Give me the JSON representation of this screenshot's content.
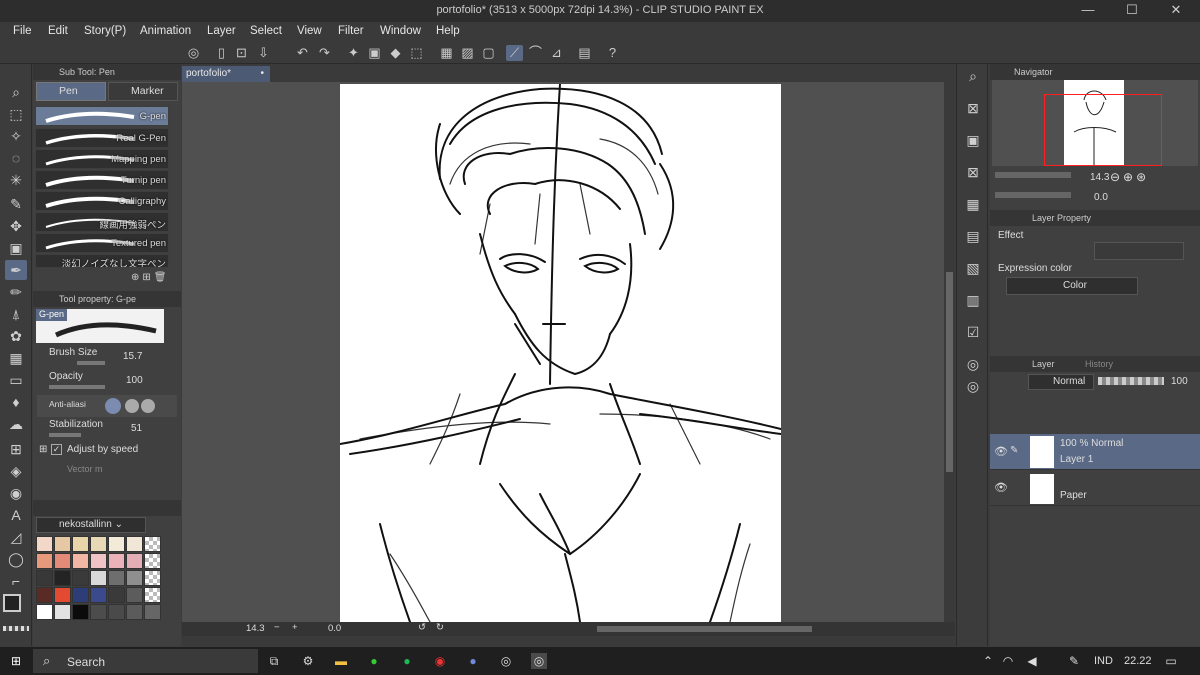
{
  "title": "portofolio* (3513 x 5000px 72dpi 14.3%) - CLIP STUDIO PAINT EX",
  "window_controls": [
    "—",
    "☐",
    "✕"
  ],
  "menu": [
    "File",
    "Edit",
    "Story(P)",
    "Animation",
    "Layer",
    "Select",
    "View",
    "Filter",
    "Window",
    "Help"
  ],
  "subtool": {
    "panel_title": "Sub Tool: Pen",
    "group_tabs": [
      "Pen",
      "Marker"
    ],
    "brushes": [
      "G-pen",
      "Real G-Pen",
      "Mapping pen",
      "Turnip pen",
      "Calligraphy",
      "線画用強弱ペン",
      "Textured pen",
      "淡幻ノイズなし文字ペン"
    ]
  },
  "tool_property": {
    "title": "Tool property: G-pe",
    "brush_name": "G-pen",
    "brush_size_label": "Brush Size",
    "brush_size": "15.7",
    "opacity_label": "Opacity",
    "opacity": "100",
    "antialias_label": "Anti-aliasi",
    "stabilization_label": "Stabilization",
    "stabilization": "51",
    "adjust_speed_label": "Adjust by speed",
    "vector_label": "Vector m"
  },
  "color_set": {
    "name": "nekostallinn",
    "swatches": [
      "#f3d7c9",
      "#e6c9a4",
      "#e8d6a8",
      "#e8d9b6",
      "#f4ead9",
      "#f2e6d6",
      "checker",
      "#e79a7b",
      "#e38a78",
      "#f1b6a4",
      "#f0c4c6",
      "#ebb3b9",
      "#e4aeb6",
      "checker",
      "#383838",
      "#242424",
      "#3a3a3a",
      "#d9d9d9",
      "#6e6e6e",
      "#8f8f8f",
      "checker",
      "#5a2a24",
      "#e24a32",
      "#2d3d78",
      "#3a4a8c",
      "#3a3a3a",
      "#5c5c5c",
      "checker",
      "#ffffff",
      "#e2e2e2",
      "#0b0b0b",
      "#4c4c4c",
      "#4a4a4a",
      "#5b5b5b",
      "#666666"
    ]
  },
  "document": {
    "tab_label": "portofolio*",
    "zoom": "14.3",
    "rotation": "0.0"
  },
  "navigator": {
    "title": "Navigator",
    "zoom": "14.3",
    "rotation": "0.0"
  },
  "layer_property": {
    "title": "Layer Property",
    "effect_label": "Effect",
    "expression_color_label": "Expression color",
    "expression_color_value": "Color"
  },
  "layers": {
    "tabs": [
      "Layer",
      "History"
    ],
    "blend_mode": "Normal",
    "opacity": "100",
    "items": [
      {
        "line1": "100 % Normal",
        "line2": "Layer 1",
        "selected": true
      },
      {
        "line1": "",
        "line2": "Paper",
        "selected": false
      }
    ]
  },
  "taskbar": {
    "search_label": "Search",
    "language": "IND",
    "time": "22.22"
  },
  "colors": {
    "accent": "#5a6a86",
    "selection": "#6b7c99",
    "navigator_frame": "#ff2020"
  }
}
